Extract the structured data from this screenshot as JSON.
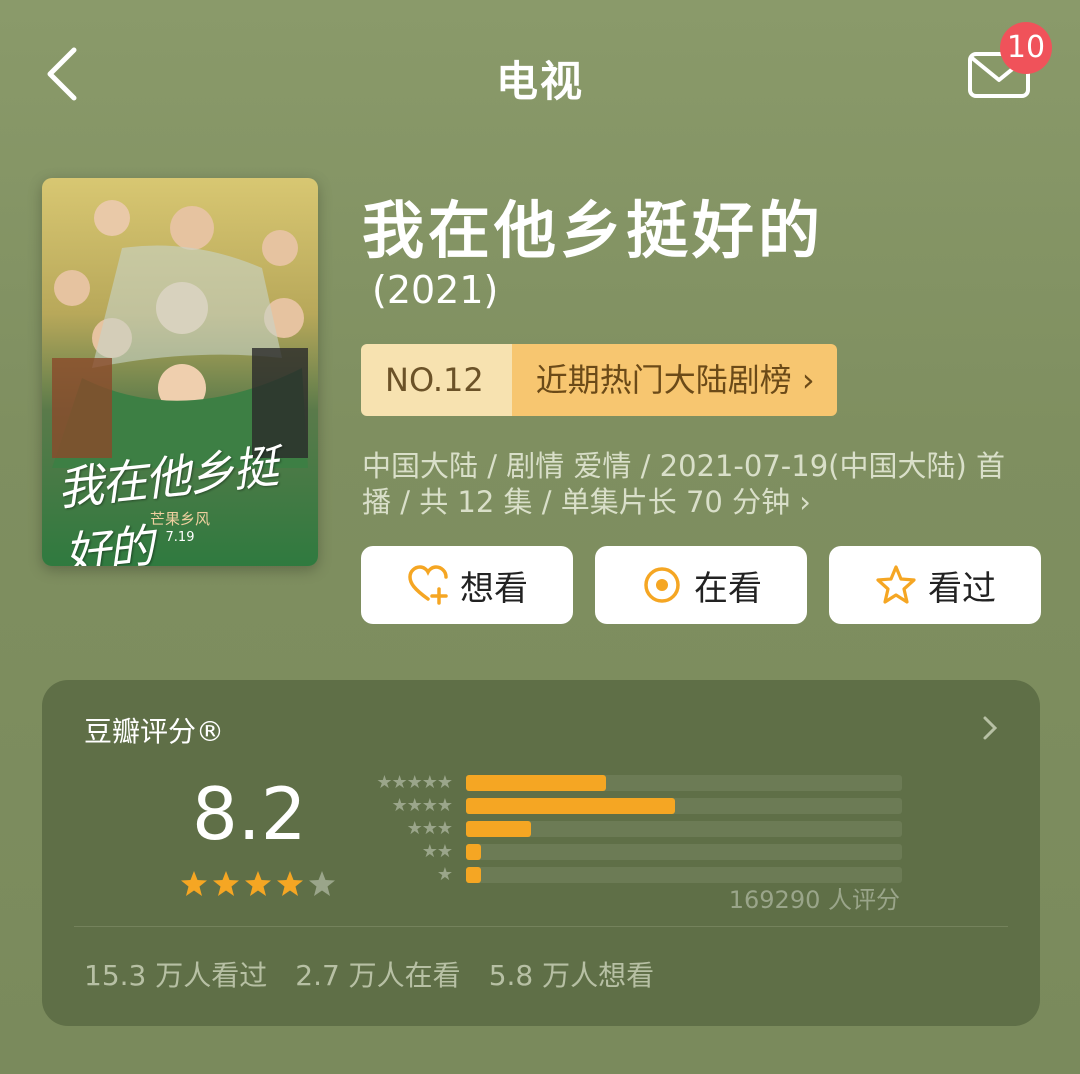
{
  "header": {
    "title": "电视",
    "badge_count": "10"
  },
  "show": {
    "title": "我在他乡挺好的",
    "year": "(2021)",
    "rank_no": "NO.12",
    "rank_list": "近期热门大陆剧榜 ›",
    "meta_line1": "中国大陆 / 剧情 爱情 / 2021-07-19(中国大陆) 首",
    "meta_line2": "播 / 共 12 集 / 单集片长 70 分钟 ›",
    "poster_calligraphy": "我在他乡挺好的",
    "poster_subtitle": "芒果乡风",
    "poster_date": "7.19"
  },
  "actions": [
    {
      "label": "想看",
      "icon": "heart-plus-icon"
    },
    {
      "label": "在看",
      "icon": "target-icon"
    },
    {
      "label": "看过",
      "icon": "star-icon"
    }
  ],
  "rating": {
    "title": "豆瓣评分®",
    "score": "8.2",
    "stars": 4,
    "distribution": [
      {
        "stars": 5,
        "pct": 0.32
      },
      {
        "stars": 4,
        "pct": 0.48
      },
      {
        "stars": 3,
        "pct": 0.15
      },
      {
        "stars": 2,
        "pct": 0.035
      },
      {
        "stars": 1,
        "pct": 0.035
      }
    ],
    "raters": "169290 人评分",
    "watched": "15.3 万人看过",
    "watching": "2.7 万人在看",
    "want": "5.8 万人想看"
  },
  "colors": {
    "accent": "#f5a623",
    "badge": "#f0525a",
    "card": "#5f6f47"
  }
}
